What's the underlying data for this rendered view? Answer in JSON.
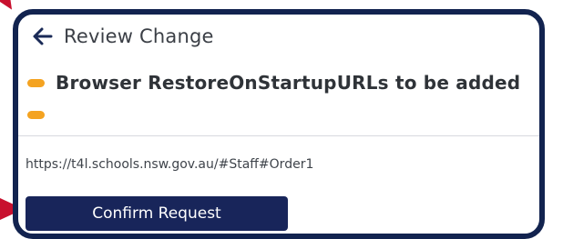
{
  "header": {
    "title": "Review Change",
    "back_icon": "arrow-left-icon"
  },
  "change": {
    "title": "Browser RestoreOnStartupURLs to be added",
    "bullet_color": "#f4a321",
    "value": "https://t4l.schools.nsw.gov.au/#Staff#Order1"
  },
  "actions": {
    "confirm_label": "Confirm Request"
  },
  "colors": {
    "frame": "#12234f",
    "button": "#18255a",
    "accent": "#c8102e"
  }
}
